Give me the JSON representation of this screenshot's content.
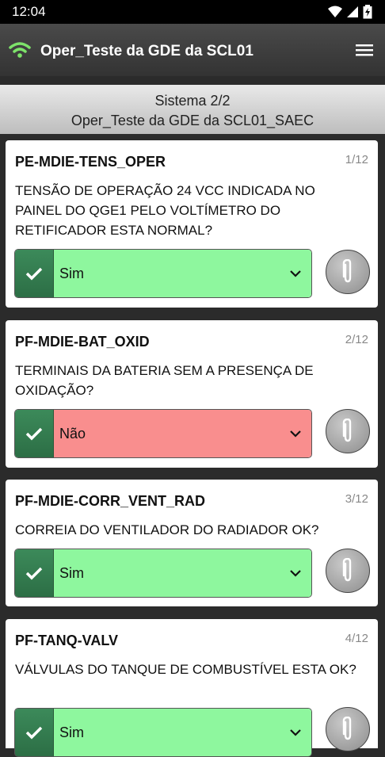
{
  "status_bar": {
    "time": "12:04"
  },
  "app_bar": {
    "title": "Oper_Teste da GDE da SCL01"
  },
  "system_header": {
    "line1": "Sistema 2/2",
    "line2": "Oper_Teste da GDE da SCL01_SAEC"
  },
  "items": [
    {
      "code": "PE-MDIE-TENS_OPER",
      "count": "1/12",
      "question": "TENSÃO DE OPERAÇÃO 24 VCC INDICADA NO PAINEL DO QGE1 PELO VOLTÍMETRO DO RETIFICADOR ESTA NORMAL?",
      "answer": "Sim",
      "answer_color": "#8ef79e"
    },
    {
      "code": "PF-MDIE-BAT_OXID",
      "count": "2/12",
      "question": "TERMINAIS DA BATERIA SEM A PRESENÇA DE OXIDAÇÃO?",
      "answer": "Não",
      "answer_color": "#f98e8e"
    },
    {
      "code": "PF-MDIE-CORR_VENT_RAD",
      "count": "3/12",
      "question": "CORREIA DO VENTILADOR DO RADIADOR OK?",
      "answer": "Sim",
      "answer_color": "#8ef79e"
    },
    {
      "code": "PF-TANQ-VALV",
      "count": "4/12",
      "question": "VÁLVULAS DO TANQUE DE COMBUSTÍVEL ESTA OK?",
      "answer": "Sim",
      "answer_color": "#8ef79e"
    }
  ]
}
